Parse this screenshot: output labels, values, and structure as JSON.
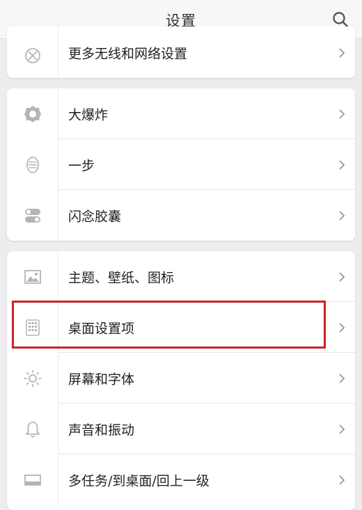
{
  "header": {
    "title": "设置",
    "search_icon": "search-icon"
  },
  "groups": [
    {
      "items": [
        {
          "label": "更多无线和网络设置",
          "icon": "wireless-network-icon"
        }
      ]
    },
    {
      "items": [
        {
          "label": "大爆炸",
          "icon": "big-bang-icon"
        },
        {
          "label": "一步",
          "icon": "one-step-icon"
        },
        {
          "label": "闪念胶囊",
          "icon": "capsule-icon"
        }
      ]
    },
    {
      "items": [
        {
          "label": "主题、壁纸、图标",
          "icon": "wallpaper-icon"
        },
        {
          "label": "桌面设置项",
          "icon": "desktop-grid-icon"
        },
        {
          "label": "屏幕和字体",
          "icon": "brightness-icon"
        },
        {
          "label": "声音和振动",
          "icon": "bell-icon"
        },
        {
          "label": "多任务/到桌面/回上一级",
          "icon": "navigation-bar-icon"
        }
      ]
    }
  ],
  "colors": {
    "highlight": "#cc2229",
    "background": "#ededed",
    "card": "#ffffff"
  }
}
